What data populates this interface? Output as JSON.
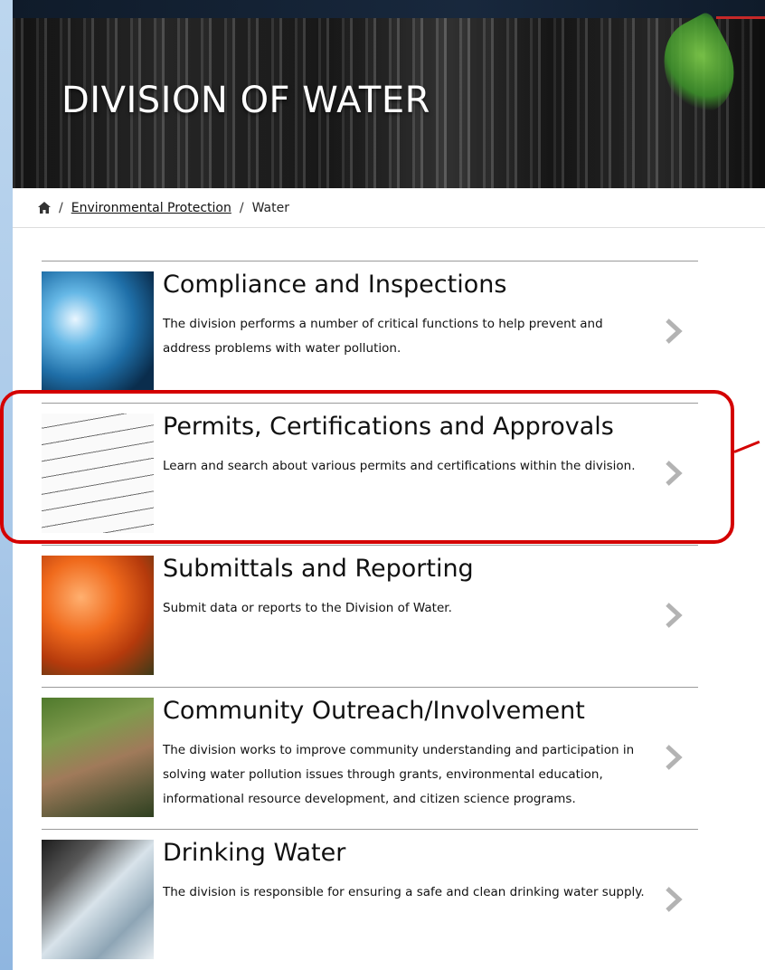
{
  "hero": {
    "title": "DIVISION OF WATER"
  },
  "breadcrumb": {
    "home_icon": "home-icon",
    "separator": "/",
    "link": "Environmental Protection",
    "current": "Water"
  },
  "items": [
    {
      "title": "Compliance and Inspections",
      "desc": "The division performs a number of critical functions to help prevent and address problems with water pollution."
    },
    {
      "title": "Permits, Certifications and Approvals",
      "desc": "Learn and search about various permits and certifications within the division."
    },
    {
      "title": "Submittals and Reporting",
      "desc": "Submit data or reports to the Division of Water."
    },
    {
      "title": "Community Outreach/Involvement",
      "desc": "The division works to improve community understanding and participation in solving water pollution issues through grants, environmental education, informational resource development, and citizen science programs."
    },
    {
      "title": "Drinking Water",
      "desc": "The division is responsible for ensuring a safe and clean drinking water supply."
    }
  ],
  "icons": {
    "chevron": "chevron-right-icon"
  },
  "colors": {
    "highlight": "#d40000",
    "chevron": "#b3b3b3"
  }
}
